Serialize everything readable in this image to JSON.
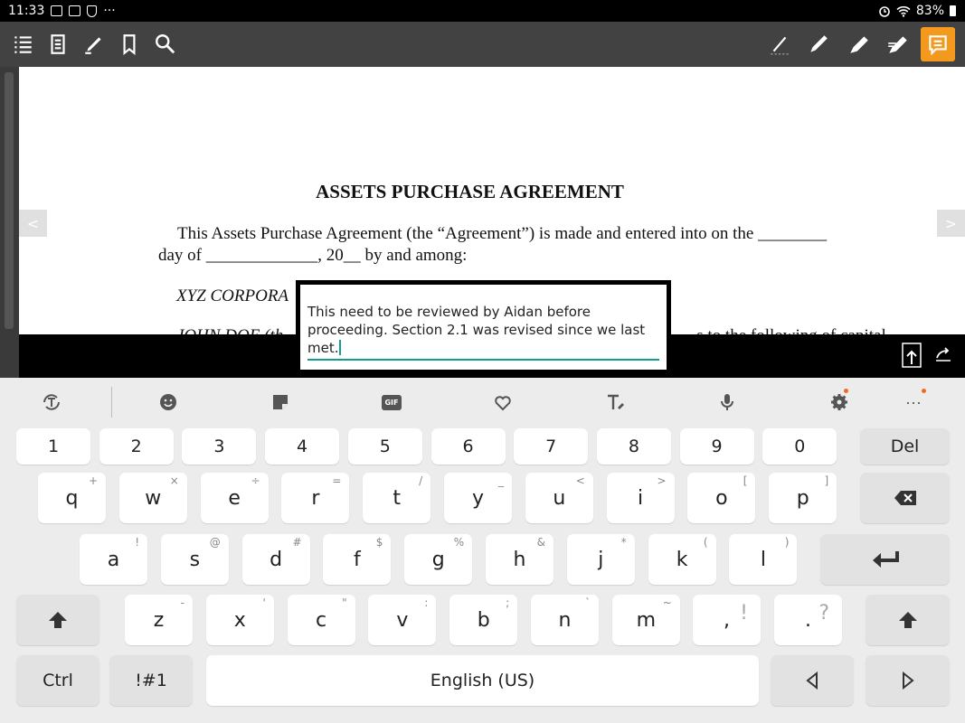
{
  "status_bar": {
    "time": "11:33",
    "more": "···",
    "battery": "83%"
  },
  "toolbar": {
    "left_icons": [
      "list-icon",
      "pages-icon",
      "highlighter-icon",
      "bookmark-icon",
      "search-icon"
    ],
    "right_icons": [
      "pen-thin-icon",
      "pen-icon",
      "marker-icon",
      "highlighter-pen-icon",
      "note-icon"
    ],
    "accent": "#f39a1e"
  },
  "document": {
    "prev": "<",
    "next": ">",
    "title": "ASSETS PURCHASE AGREEMENT",
    "line1": "This Assets Purchase Agreement (the “Agreement”) is made and entered into on the ________",
    "line2": "day of _____________, 20__ by and among:",
    "line3": "XYZ CORPORA",
    "line4_left": "JOHN DOE (th",
    "line4_right": "...s to the following of capital"
  },
  "note": {
    "text": "This need to be reviewed by Aidan before proceeding. Section 2.1 was revised since we last met.",
    "accent": "#139e8a"
  },
  "keyboard": {
    "toolbar": [
      "text-mode-icon",
      "emoji-icon",
      "sticker-icon",
      "gif-icon",
      "heart-icon",
      "text-style-icon",
      "mic-icon",
      "settings-icon",
      "more-icon"
    ],
    "gif_label": "GIF",
    "more_label": "···",
    "row_num": [
      "1",
      "2",
      "3",
      "4",
      "5",
      "6",
      "7",
      "8",
      "9",
      "0"
    ],
    "del": "Del",
    "row_q": [
      {
        "k": "q",
        "h": "+"
      },
      {
        "k": "w",
        "h": "×"
      },
      {
        "k": "e",
        "h": "÷"
      },
      {
        "k": "r",
        "h": "="
      },
      {
        "k": "t",
        "h": "/"
      },
      {
        "k": "y",
        "h": "_"
      },
      {
        "k": "u",
        "h": "<"
      },
      {
        "k": "i",
        "h": ">"
      },
      {
        "k": "o",
        "h": "["
      },
      {
        "k": "p",
        "h": "]"
      }
    ],
    "row_a": [
      {
        "k": "a",
        "h": "!"
      },
      {
        "k": "s",
        "h": "@"
      },
      {
        "k": "d",
        "h": "#"
      },
      {
        "k": "f",
        "h": "$"
      },
      {
        "k": "g",
        "h": "%"
      },
      {
        "k": "h",
        "h": "&"
      },
      {
        "k": "j",
        "h": "*"
      },
      {
        "k": "k",
        "h": "("
      },
      {
        "k": "l",
        "h": ")"
      }
    ],
    "row_z": [
      {
        "k": "z",
        "h": "-"
      },
      {
        "k": "x",
        "h": "'"
      },
      {
        "k": "c",
        "h": "\""
      },
      {
        "k": "v",
        "h": ":"
      },
      {
        "k": "b",
        "h": ";"
      },
      {
        "k": "n",
        "h": "`"
      },
      {
        "k": "m",
        "h": "~"
      }
    ],
    "comma": ",",
    "comma_alt": "!",
    "period": ".",
    "period_alt": "?",
    "ctrl": "Ctrl",
    "symbols": "!#1",
    "space": "English (US)"
  }
}
